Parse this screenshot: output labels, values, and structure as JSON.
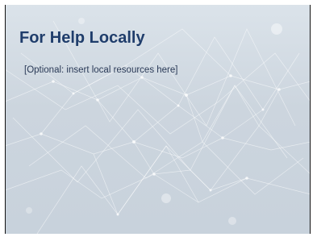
{
  "slide": {
    "title": "For Help Locally",
    "body": "[Optional: insert local resources here]"
  },
  "colors": {
    "title": "#1f3d6b",
    "body": "#2a3a57",
    "background": "#ccd5de",
    "network_lines": "#ffffff"
  }
}
